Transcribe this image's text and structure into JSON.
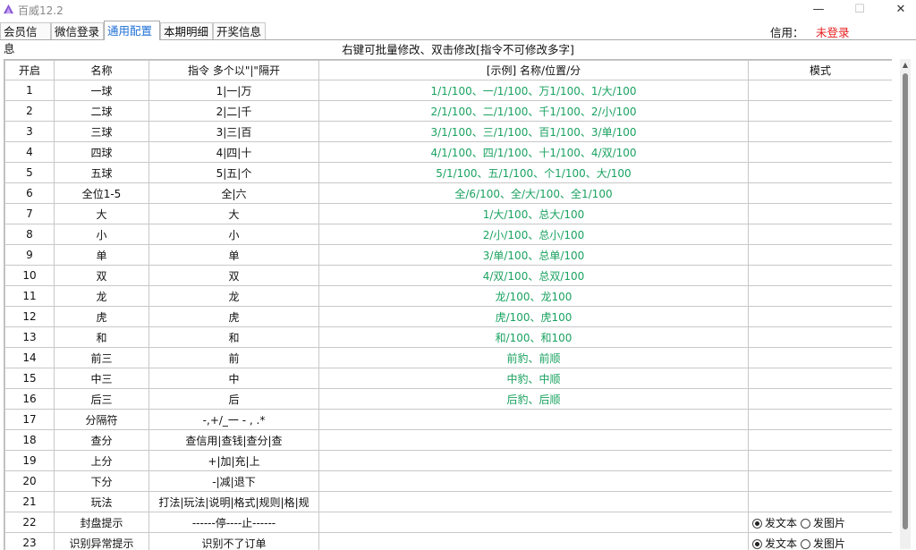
{
  "window": {
    "title": "百威12.2",
    "icon": "app-logo-icon",
    "minimize": "—",
    "maximize": "☐",
    "close": "✕"
  },
  "tabs": [
    {
      "label": "会员信息",
      "active": false
    },
    {
      "label": "微信登录",
      "active": false
    },
    {
      "label": "通用配置",
      "active": true
    },
    {
      "label": "本期明细",
      "active": false
    },
    {
      "label": "开奖信息",
      "active": false
    }
  ],
  "credit": {
    "label": "信用：",
    "value": "未登录",
    "value_color": "#e61e1e"
  },
  "hint": "右键可批量修改、双击修改[指令不可修改多字]",
  "table": {
    "headers": [
      "开启",
      "名称",
      "指令 多个以\"|\"隔开",
      "[示例] 名称/位置/分",
      "模式"
    ],
    "rows": [
      {
        "num": "1",
        "name": "一球",
        "cmd": "1|一|万",
        "example": "1/1/100、一/1/100、万1/100、1/大/100"
      },
      {
        "num": "2",
        "name": "二球",
        "cmd": "2|二|千",
        "example": "2/1/100、二/1/100、千1/100、2/小/100"
      },
      {
        "num": "3",
        "name": "三球",
        "cmd": "3|三|百",
        "example": "3/1/100、三/1/100、百1/100、3/单/100"
      },
      {
        "num": "4",
        "name": "四球",
        "cmd": "4|四|十",
        "example": "4/1/100、四/1/100、十1/100、4/双/100"
      },
      {
        "num": "5",
        "name": "五球",
        "cmd": "5|五|个",
        "example": "5/1/100、五/1/100、个1/100、大/100"
      },
      {
        "num": "6",
        "name": "全位1-5",
        "cmd": "全|六",
        "example": "全/6/100、全/大/100、全1/100"
      },
      {
        "num": "7",
        "name": "大",
        "cmd": "大",
        "example": "1/大/100、总大/100"
      },
      {
        "num": "8",
        "name": "小",
        "cmd": "小",
        "example": "2/小/100、总小/100"
      },
      {
        "num": "9",
        "name": "单",
        "cmd": "单",
        "example": "3/单/100、总单/100"
      },
      {
        "num": "10",
        "name": "双",
        "cmd": "双",
        "example": "4/双/100、总双/100"
      },
      {
        "num": "11",
        "name": "龙",
        "cmd": "龙",
        "example": "龙/100、龙100"
      },
      {
        "num": "12",
        "name": "虎",
        "cmd": "虎",
        "example": "虎/100、虎100"
      },
      {
        "num": "13",
        "name": "和",
        "cmd": "和",
        "example": "和/100、和100"
      },
      {
        "num": "14",
        "name": "前三",
        "cmd": "前",
        "example": "前豹、前顺"
      },
      {
        "num": "15",
        "name": "中三",
        "cmd": "中",
        "example": "中豹、中顺"
      },
      {
        "num": "16",
        "name": "后三",
        "cmd": "后",
        "example": "后豹、后顺"
      },
      {
        "num": "17",
        "name": "分隔符",
        "cmd": "-,+/_一 - , .*",
        "example": ""
      },
      {
        "num": "18",
        "name": "查分",
        "cmd": "查信用|查钱|查分|查",
        "example": ""
      },
      {
        "num": "19",
        "name": "上分",
        "cmd": "+|加|充|上",
        "example": ""
      },
      {
        "num": "20",
        "name": "下分",
        "cmd": "-|减|退下",
        "example": ""
      },
      {
        "num": "21",
        "name": "玩法",
        "cmd": "打法|玩法|说明|格式|规则|格|规",
        "example": ""
      },
      {
        "num": "22",
        "name": "封盘提示",
        "cmd": "------停----止------",
        "example": "",
        "mode": true
      },
      {
        "num": "23",
        "name": "识别异常提示",
        "cmd": "识别不了订单",
        "example": "",
        "mode": true
      }
    ],
    "mode_options": [
      "发文本",
      "发图片"
    ],
    "mode_selected": "发文本"
  },
  "colors": {
    "accent": "#1e6fd6",
    "example_text": "#1aa260",
    "alert": "#e61e1e"
  }
}
